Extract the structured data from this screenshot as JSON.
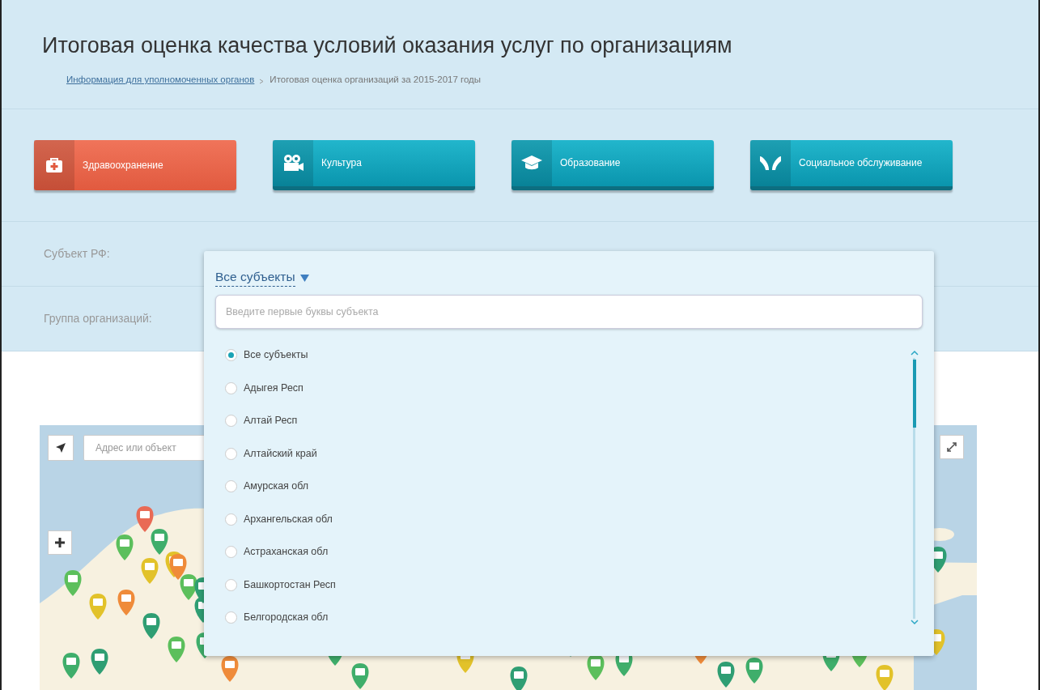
{
  "header": {
    "title": "Итоговая оценка качества условий оказания услуг по организациям",
    "breadcrumb": [
      {
        "text": "Информация для уполномоченных органов",
        "kind": "link"
      },
      {
        "text": "Итоговая оценка организаций за 2015-2017 годы",
        "kind": "current"
      }
    ]
  },
  "categories": [
    {
      "label": "Здравоохранение",
      "selected": true
    },
    {
      "label": "Культура",
      "selected": false
    },
    {
      "label": "Образование",
      "selected": false
    },
    {
      "label": "Социальное обслуживание",
      "selected": false
    }
  ],
  "filters": [
    {
      "label": "Субъект РФ:"
    },
    {
      "label": "Группа организаций:"
    }
  ],
  "dropdown": {
    "value": "Все субъекты",
    "search_placeholder": "Введите первые буквы субъекта",
    "options": [
      {
        "label": "Все субъекты",
        "selected": true
      },
      {
        "label": "Адыгея Респ",
        "selected": false
      },
      {
        "label": "Алтай Респ",
        "selected": false
      },
      {
        "label": "Алтайский край",
        "selected": false
      },
      {
        "label": "Амурская обл",
        "selected": false
      },
      {
        "label": "Архангельская обл",
        "selected": false
      },
      {
        "label": "Астраханская обл",
        "selected": false
      },
      {
        "label": "Башкортостан Респ",
        "selected": false
      },
      {
        "label": "Белгородская обл",
        "selected": false
      }
    ]
  },
  "map": {
    "search_placeholder": "Адрес или объект"
  }
}
